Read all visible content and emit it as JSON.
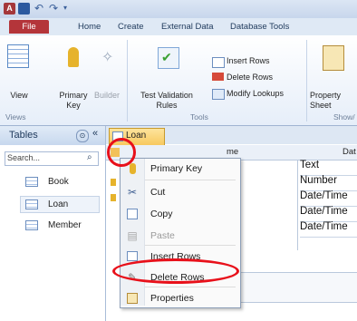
{
  "quick_access": {
    "undo_glyph": "↶",
    "redo_glyph": "↷",
    "dropdown_glyph": "▾",
    "app_letter": "A"
  },
  "ribbon_tabs": [
    "File",
    "Home",
    "Create",
    "External Data",
    "Database Tools"
  ],
  "ribbon": {
    "view_label": "View",
    "primary_key_label": "Primary Key",
    "builder_label": "Builder",
    "test_validation_label": "Test Validation Rules",
    "insert_rows_label": "Insert Rows",
    "delete_rows_label": "Delete Rows",
    "modify_lookups_label": "Modify Lookups",
    "property_sheet_label": "Property Sheet",
    "groups": {
      "views": "Views",
      "tools": "Tools",
      "show": "Show/"
    }
  },
  "nav_pane": {
    "title": "Tables",
    "collapse_glyph": "«",
    "menu_glyph": "⊙",
    "search_text": "Search...",
    "items": [
      "Book",
      "Loan",
      "Member"
    ]
  },
  "document": {
    "tab_label": "Loan",
    "headers": {
      "field_name": "me",
      "data_type": "Dat"
    },
    "data_types": [
      "Text",
      "Number",
      "Date/Time",
      "Date/Time",
      "Date/Time"
    ]
  },
  "context_menu": {
    "items": [
      "Primary Key",
      "Cut",
      "Copy",
      "Paste",
      "Insert Rows",
      "Delete Rows",
      "Properties"
    ],
    "disabled": [
      "Paste"
    ]
  },
  "colors": {
    "annotation": "#e8101a",
    "file_tab": "#b4353a",
    "ribbon_bg": "#e6eef9"
  }
}
